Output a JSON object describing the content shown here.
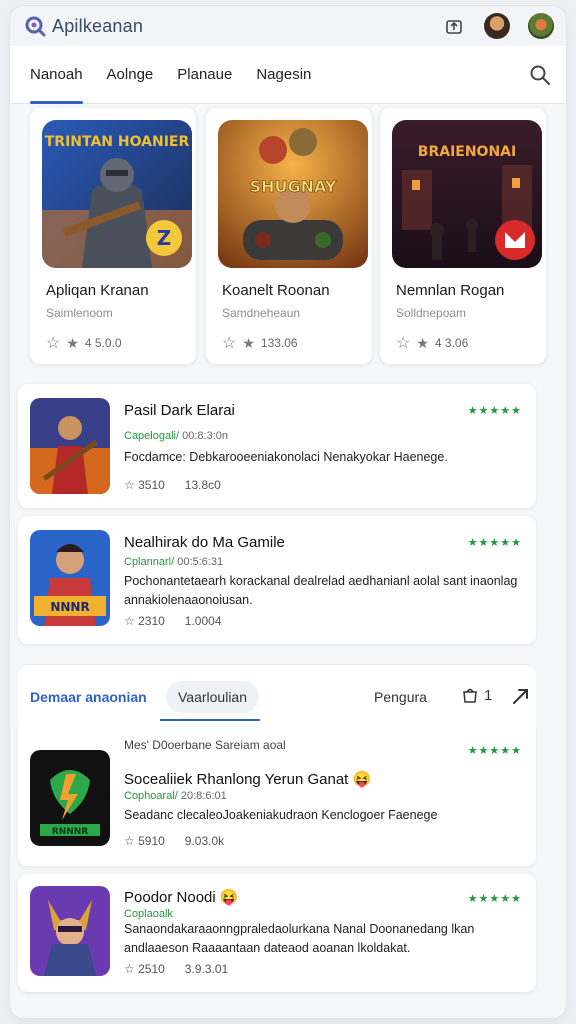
{
  "app": {
    "title": "Apilkeanan"
  },
  "tabs": [
    {
      "label": "Nanoah",
      "active": true
    },
    {
      "label": "Aolnge",
      "active": false
    },
    {
      "label": "Planaue",
      "active": false
    },
    {
      "label": "Nagesin",
      "active": false
    }
  ],
  "featured": [
    {
      "name": "Apliqan Kranan",
      "sub": "Saimlenoom",
      "rating": "4 5.0.0",
      "art_text": "TRINTAN HOANIER"
    },
    {
      "name": "Koanelt Roonan",
      "sub": "Samdneheaun",
      "rating": "133.06",
      "art_text": "SHUGNAY"
    },
    {
      "name": "Nemnlan Rogan",
      "sub": "Solldnepoam",
      "rating": "4 3.06",
      "art_text": "BRAIENONAI"
    }
  ],
  "list_items": [
    {
      "title": "Pasil Dark Elarai",
      "meta_green": "Capelogali/",
      "meta_rest": "00:8:3:0n",
      "desc": "Focdamce: Debkarooeeniakonolaci Nenakyokar Haenege.",
      "stat1": "3510",
      "stat2": "13.8c0",
      "stars": "★★★★★"
    },
    {
      "title": "Nealhirak do Ma Gamile",
      "meta_green": "Cplannarl/",
      "meta_rest": "00:5:6:31",
      "desc": "Pochonantetaearh korackanal dealrelad aedhanianl aolal sant inaonlag annakiolenaaonoiusan.",
      "stat1": "2310",
      "stat2": "1.0004",
      "stars": "★★★★★"
    }
  ],
  "section2": {
    "tab1": "Demaar anaonian",
    "tab2": "Vaarloulian",
    "right_label": "Pengura",
    "count": "1",
    "caption": "Mes' D0oerbane Sareiam aoal"
  },
  "list_items2": [
    {
      "title": "Socealiiek Rhanlong Yerun Ganat 😝",
      "meta_green": "Cophoaral/",
      "meta_rest": "20:8:6:01",
      "desc": "Seadanc clecaleoJoakeniakudraon Kenclogoer Faenege",
      "stat1": "5910",
      "stat2": "9.03.0k",
      "stars": "★★★★★"
    },
    {
      "title": "Poodor Noodi 😝",
      "meta_green": "Coplaoalk",
      "meta_rest": "",
      "desc": "Sanaondakaraaonngpraledaolurkana Nanal Doonanedang lkan andlaaeson Raaaantaan dateaod aoanan lkoldakat.",
      "stat1": "2510",
      "stat2": "3.9.3.01",
      "stars": "★★★★★"
    }
  ],
  "colors": {
    "accent": "#2d63c8",
    "rating_green": "#1f9a3a"
  }
}
